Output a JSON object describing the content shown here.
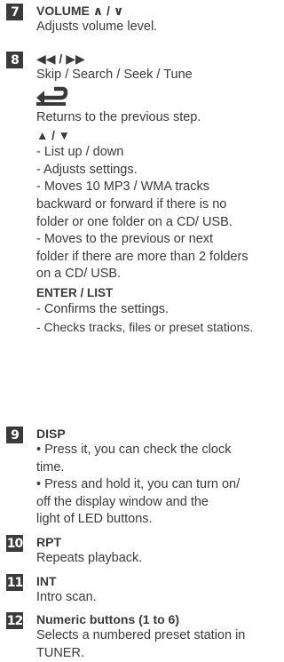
{
  "items": [
    {
      "number": "7",
      "title": "VOLUME ∧ / ∨",
      "lines": [
        "Adjusts volume level."
      ]
    },
    {
      "number": "8",
      "title": "◀◀ / ▶▶",
      "lines": [
        "Skip / Search / Seek / Tune"
      ],
      "return": {
        "icon": "return-arrow-icon",
        "lines": [
          "Returns to the previous step."
        ]
      },
      "updown": {
        "title": "▲ / ▼",
        "lines": [
          "- List up / down",
          "- Adjusts settings.",
          "- Moves 10 MP3 / WMA tracks",
          "backward or forward if there is no",
          "folder or one folder on a CD/ USB.",
          "- Moves to the previous or next",
          "folder if there are more than 2 folders",
          "on a CD/ USB."
        ]
      },
      "enter": {
        "title": "ENTER / LIST",
        "lines": [
          "- Confirms the settings.",
          "- Checks tracks, files or preset stations."
        ]
      }
    },
    {
      "number": "9",
      "title": "DISP",
      "lines": [
        "• Press it, you can check the clock",
        "time.",
        "• Press and hold it, you can turn on/",
        "off the display window and the",
        "light of LED buttons."
      ]
    },
    {
      "number": "10",
      "title": "RPT",
      "lines": [
        "Repeats playback."
      ]
    },
    {
      "number": "11",
      "title": "INT",
      "lines": [
        "Intro scan."
      ]
    },
    {
      "number": "12",
      "title": "Numeric buttons (1 to 6)",
      "lines": [
        "Selects a numbered preset station in",
        "TUNER."
      ]
    }
  ],
  "colors": {
    "text": "#3a3a3a",
    "badge": "#3a3a3a",
    "badge_text": "#ffffff"
  }
}
